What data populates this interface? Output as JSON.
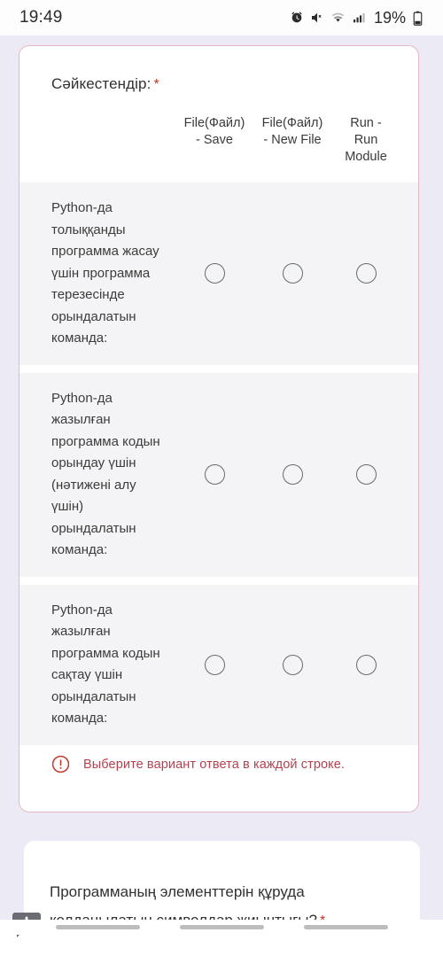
{
  "status_bar": {
    "time": "19:49",
    "battery_percent": "19%",
    "icons": [
      "alarm-icon",
      "mute-icon",
      "wifi-icon",
      "signal-icon",
      "battery-icon"
    ]
  },
  "question": {
    "title": "Сәйкестендір:",
    "required_marker": "*",
    "columns": [
      {
        "line1": "File(Файл)",
        "line2": "- Save",
        "line3": ""
      },
      {
        "line1": "File(Файл)",
        "line2": "- New File",
        "line3": ""
      },
      {
        "line1": "Run -",
        "line2": "Run",
        "line3": "Module"
      }
    ],
    "rows": [
      {
        "label": "Python-да толыққанды программа жасау үшін программа терезесінде орындалатын команда:",
        "selected": null
      },
      {
        "label": "Python-да жазылған программа кодын орындау үшін (нәтижені алу үшін) орындалатын команда:",
        "selected": null
      },
      {
        "label": "Python-да жазылған программа кодын сақтау үшін орындалатын команда:",
        "selected": null
      }
    ],
    "error": {
      "icon": "error-exclamation-icon",
      "text": "Выберите вариант ответа в каждой строке."
    }
  },
  "next_question": {
    "badge_icon": "comment-exclamation-icon",
    "title": "Программаның элементтерін құруда қолданылатын символдар жиынтығы?",
    "required_marker": "*"
  },
  "colors": {
    "page_background": "#eceaf4",
    "card_background": "#ffffff",
    "error_border": "#e2b9c4",
    "error_text": "#b6414f",
    "row_background": "#f4f4f6",
    "required_star": "#c0392b"
  }
}
